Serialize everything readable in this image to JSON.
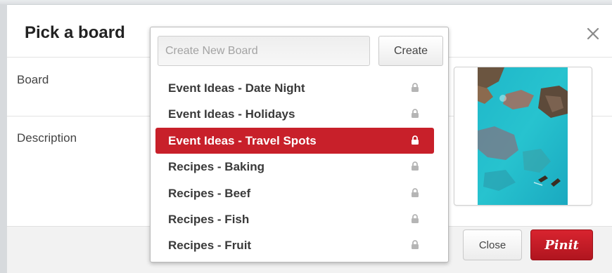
{
  "modal": {
    "title": "Pick a board",
    "close_icon": "close-x-icon"
  },
  "form": {
    "board_label": "Board",
    "description_label": "Description"
  },
  "dropdown": {
    "create_placeholder": "Create New Board",
    "create_value": "",
    "create_button_label": "Create",
    "boards": [
      {
        "label": "Event Ideas - Date Night",
        "secret": true,
        "selected": false
      },
      {
        "label": "Event Ideas - Holidays",
        "secret": true,
        "selected": false
      },
      {
        "label": "Event Ideas - Travel Spots",
        "secret": true,
        "selected": true
      },
      {
        "label": "Recipes - Baking",
        "secret": true,
        "selected": false
      },
      {
        "label": "Recipes - Beef",
        "secret": true,
        "selected": false
      },
      {
        "label": "Recipes - Fish",
        "secret": true,
        "selected": false
      },
      {
        "label": "Recipes - Fruit",
        "secret": true,
        "selected": false
      }
    ],
    "lock_icon": "lock-icon"
  },
  "preview": {
    "image": "coastal-water-photo"
  },
  "footer": {
    "close_label": "Close",
    "pinit_label": "Pinit"
  },
  "colors": {
    "accent": "#c8202a",
    "lock_gray": "#b5b5b5"
  }
}
